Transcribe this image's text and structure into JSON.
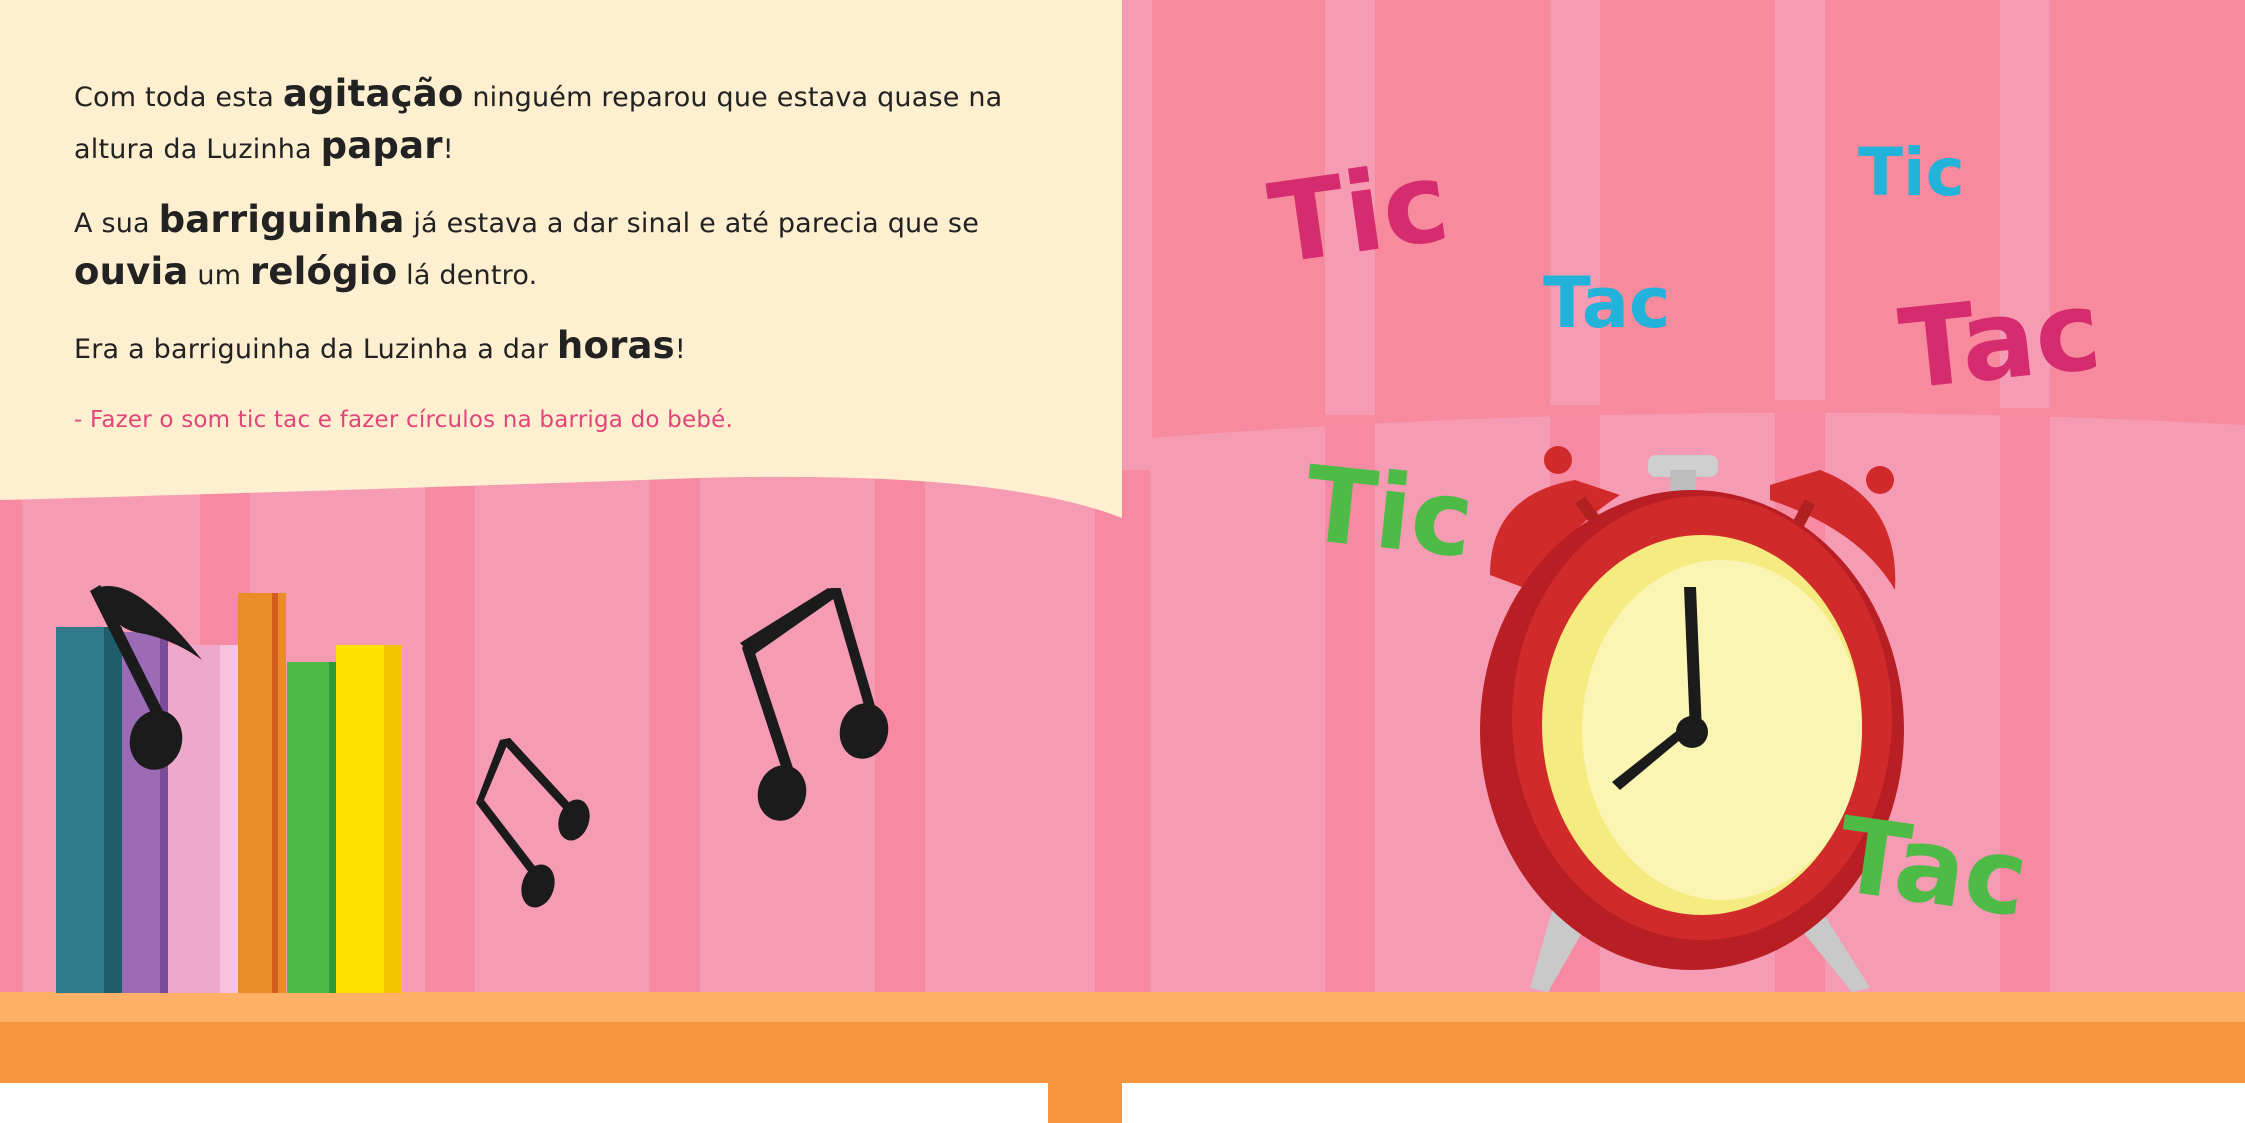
{
  "story": {
    "p1": {
      "t1": "Com toda esta ",
      "b1": "agitação",
      "t2": " ninguém reparou que estava quase na altura da Luzinha ",
      "b2": "papar",
      "t3": "!"
    },
    "p2": {
      "t1": "A sua ",
      "b1": "barriguinha",
      "t2": " já estava a dar sinal e até parecia que se ",
      "b2": "ouvia",
      "t3": " um ",
      "b3": "relógio",
      "t4": " lá dentro."
    },
    "p3": {
      "t1": "Era a barriguinha da Luzinha a dar ",
      "b1": "horas",
      "t2": "!"
    },
    "instruction": "- Fazer o som tic tac e fazer círculos na barriga do bebé."
  },
  "sounds": {
    "w1": "Tic",
    "w2": "Tic",
    "w3": "Tac",
    "w4": "Tac",
    "w5": "Tic",
    "w6": "Tac"
  },
  "colors": {
    "panel": "#fdefcf",
    "magenta": "#d42c6f",
    "blue": "#23b2d9",
    "green": "#4dbb46",
    "shelf": "#f7963e",
    "clock_red": "#d12a2a"
  },
  "icons": [
    "music-note-icon",
    "alarm-clock-icon"
  ]
}
